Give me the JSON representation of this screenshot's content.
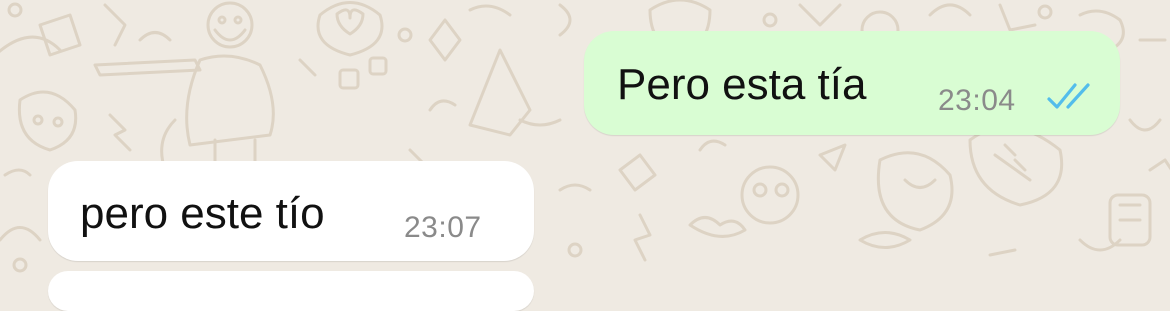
{
  "chat": {
    "messages": [
      {
        "direction": "outgoing",
        "text": "Pero esta tía",
        "time": "23:04",
        "status_icon": "double-check-read-icon"
      },
      {
        "direction": "incoming",
        "text": "pero este tío",
        "time": "23:07"
      }
    ]
  },
  "colors": {
    "background": "#efeae2",
    "outgoing_bubble": "#d9fdd3",
    "incoming_bubble": "#ffffff",
    "read_ticks": "#53bdeb",
    "timestamp": "#8a8a8a"
  }
}
